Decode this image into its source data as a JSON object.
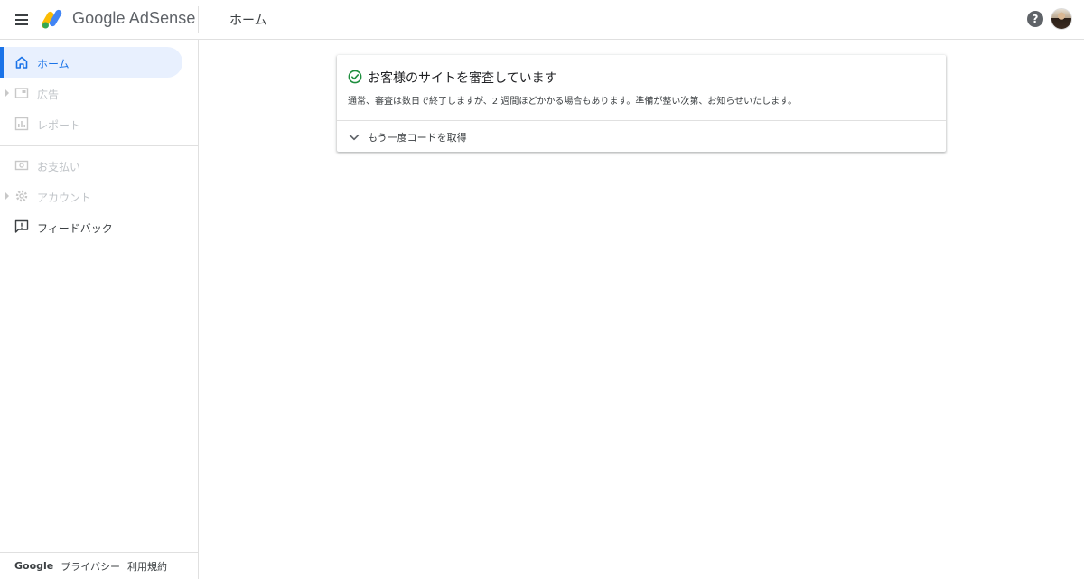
{
  "header": {
    "brand": "Google AdSense",
    "page_title": "ホーム",
    "help_symbol": "?"
  },
  "sidebar": {
    "items": [
      {
        "label": "ホーム",
        "icon": "home-icon",
        "state": "active"
      },
      {
        "label": "広告",
        "icon": "ads-icon",
        "state": "disabled",
        "expandable": true
      },
      {
        "label": "レポート",
        "icon": "reports-icon",
        "state": "disabled"
      },
      {
        "label": "お支払い",
        "icon": "payments-icon",
        "state": "disabled"
      },
      {
        "label": "アカウント",
        "icon": "gear-icon",
        "state": "disabled",
        "expandable": true
      },
      {
        "label": "フィードバック",
        "icon": "feedback-icon",
        "state": "enabled"
      }
    ]
  },
  "footer": {
    "google": "Google",
    "privacy": "プライバシー",
    "terms": "利用規約"
  },
  "card": {
    "title": "お客様のサイトを審査しています",
    "description": "通常、審査は数日で終了しますが、2 週間ほどかかる場合もあります。準備が整い次第、お知らせいたします。",
    "expand_label": "もう一度コードを取得"
  },
  "colors": {
    "accent": "#1a73e8",
    "active_bg": "#e8f0fe",
    "success": "#1e8e3e",
    "disabled": "#c0c4c8"
  }
}
